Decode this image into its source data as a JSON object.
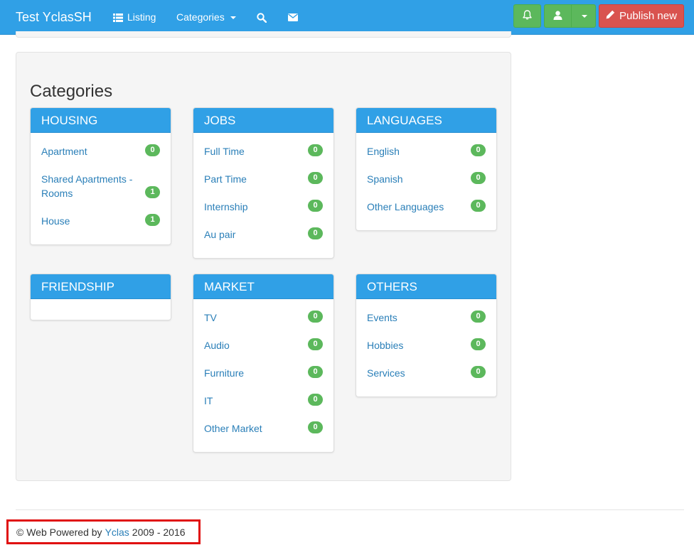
{
  "navbar": {
    "brand": "Test YclasSH",
    "listing_label": "Listing",
    "categories_label": "Categories",
    "publish_label": "Publish new"
  },
  "main": {
    "title": "Categories",
    "panels": [
      {
        "title": "HOUSING",
        "items": [
          {
            "label": "Apartment",
            "count": "0"
          },
          {
            "label": "Shared Apartments - Rooms",
            "count": "1"
          },
          {
            "label": "House",
            "count": "1"
          }
        ]
      },
      {
        "title": "JOBS",
        "items": [
          {
            "label": "Full Time",
            "count": "0"
          },
          {
            "label": "Part Time",
            "count": "0"
          },
          {
            "label": "Internship",
            "count": "0"
          },
          {
            "label": "Au pair",
            "count": "0"
          }
        ]
      },
      {
        "title": "LANGUAGES",
        "items": [
          {
            "label": "English",
            "count": "0"
          },
          {
            "label": "Spanish",
            "count": "0"
          },
          {
            "label": "Other Languages",
            "count": "0"
          }
        ]
      },
      {
        "title": "FRIENDSHIP",
        "items": []
      },
      {
        "title": "MARKET",
        "items": [
          {
            "label": "TV",
            "count": "0"
          },
          {
            "label": "Audio",
            "count": "0"
          },
          {
            "label": "Furniture",
            "count": "0"
          },
          {
            "label": "IT",
            "count": "0"
          },
          {
            "label": "Other Market",
            "count": "0"
          }
        ]
      },
      {
        "title": "OTHERS",
        "items": [
          {
            "label": "Events",
            "count": "0"
          },
          {
            "label": "Hobbies",
            "count": "0"
          },
          {
            "label": "Services",
            "count": "0"
          }
        ]
      }
    ]
  },
  "footer": {
    "prefix": "© Web Powered by",
    "link": "Yclas",
    "suffix": "2009 - 2016"
  },
  "colors": {
    "navbar": "#30a0e6",
    "success": "#5cb85c",
    "danger": "#d9534f",
    "link": "#2a7fb8"
  }
}
